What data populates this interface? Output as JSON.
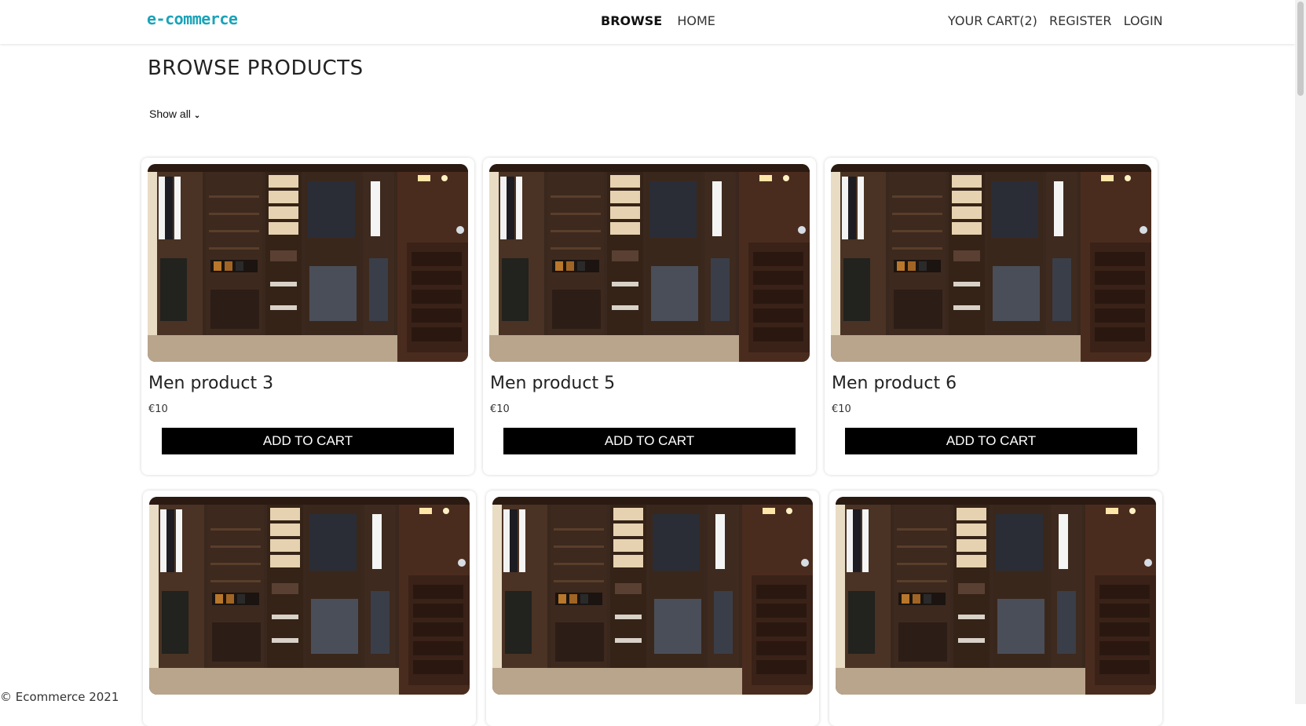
{
  "brand": "e-commerce",
  "nav": {
    "browse": "BROWSE",
    "home": "HOME",
    "cart": "YOUR CART(2)",
    "register": "REGISTER",
    "login": "LOGIN"
  },
  "page_title": "BROWSE PRODUCTS",
  "filter": {
    "selected": "Show all"
  },
  "products": [
    {
      "name": "Men product 3",
      "price": "€10",
      "button": "ADD TO CART"
    },
    {
      "name": "Men product 5",
      "price": "€10",
      "button": "ADD TO CART"
    },
    {
      "name": "Men product 6",
      "price": "€10",
      "button": "ADD TO CART"
    },
    {
      "name": "",
      "price": "",
      "button": ""
    },
    {
      "name": "",
      "price": "",
      "button": ""
    },
    {
      "name": "",
      "price": "",
      "button": ""
    }
  ],
  "footer": "© Ecommerce 2021",
  "colors": {
    "brand": "#1aa3b8",
    "button_bg": "#000000"
  }
}
